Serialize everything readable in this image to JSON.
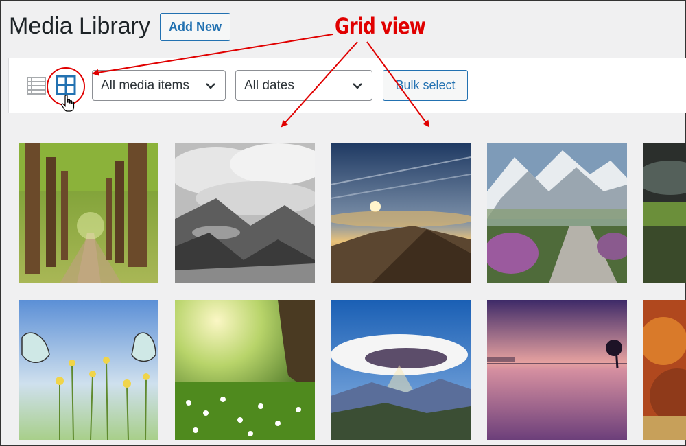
{
  "header": {
    "title": "Media Library",
    "add_new_label": "Add New"
  },
  "toolbar": {
    "list_view_icon": "list-view-icon",
    "grid_view_icon": "grid-view-icon",
    "media_filter": {
      "selected": "All media items",
      "options": [
        "All media items"
      ]
    },
    "date_filter": {
      "selected": "All dates",
      "options": [
        "All dates"
      ]
    },
    "bulk_select_label": "Bulk select"
  },
  "annotation": {
    "label": "Grid view",
    "color": "#e00000"
  },
  "colors": {
    "accent": "#2271b1",
    "background": "#f0f0f1"
  },
  "media_items": [
    {
      "subject": "forest path"
    },
    {
      "subject": "black and white mountain lake"
    },
    {
      "subject": "mountain sunset"
    },
    {
      "subject": "snowy mountain stone steps"
    },
    {
      "subject": "stormy hills"
    },
    {
      "subject": "butterflies and flowers"
    },
    {
      "subject": "sunlit meadow tree"
    },
    {
      "subject": "sunburst clouds over mountains"
    },
    {
      "subject": "purple lake sunset"
    },
    {
      "subject": "autumn forest"
    }
  ]
}
